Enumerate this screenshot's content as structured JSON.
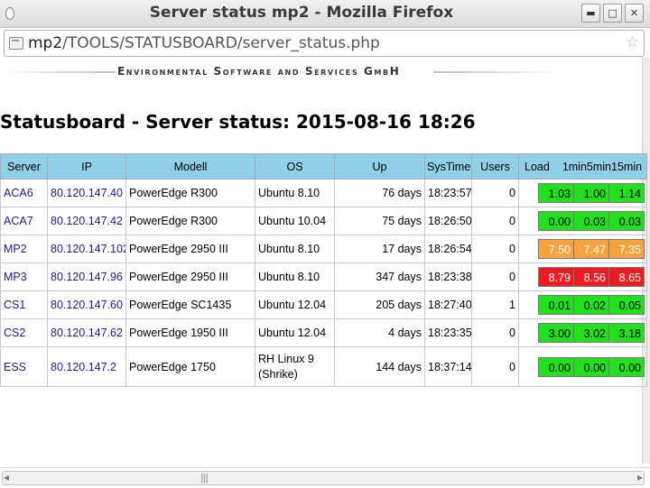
{
  "window": {
    "title": "Server status mp2 - Mozilla Firefox",
    "buttons": {
      "minimize": "▬",
      "maximize": "□",
      "close": "✕"
    }
  },
  "urlbar": {
    "host": "mp2",
    "path": "/TOOLS/STATUSBOARD/server_status.php",
    "bookmark_icon": "☆"
  },
  "banner": {
    "company": "Environmental Software and Services GmbH"
  },
  "page": {
    "heading": "Statusboard - Server status:  2015-08-16 18:26"
  },
  "table": {
    "headers": {
      "server": "Server",
      "ip": "IP",
      "modell": "Modell",
      "os": "OS",
      "up": "Up",
      "systime": "SysTime",
      "users": "Users",
      "load": "Load",
      "m1": "1min",
      "m5": "5min",
      "m15": "15min"
    },
    "rows": [
      {
        "server": "ACA6",
        "ip": "80.120.147.40",
        "modell": "PowerEdge R300",
        "os": "Ubuntu 8.10",
        "up": "76 days",
        "systime": "18:23:57",
        "users": "0",
        "load": [
          {
            "v": "1.03",
            "level": "green"
          },
          {
            "v": "1.00",
            "level": "green"
          },
          {
            "v": "1.14",
            "level": "green"
          }
        ]
      },
      {
        "server": "ACA7",
        "ip": "80.120.147.42",
        "modell": "PowerEdge R300",
        "os": "Ubuntu 10.04",
        "up": "75 days",
        "systime": "18:26:50",
        "users": "0",
        "load": [
          {
            "v": "0.00",
            "level": "green"
          },
          {
            "v": "0.03",
            "level": "green"
          },
          {
            "v": "0.03",
            "level": "green"
          }
        ]
      },
      {
        "server": "MP2",
        "ip": "80.120.147.102",
        "modell": "PowerEdge 2950 III",
        "os": "Ubuntu 8.10",
        "up": "17 days",
        "systime": "18:26:54",
        "users": "0",
        "load": [
          {
            "v": "7.50",
            "level": "orange"
          },
          {
            "v": "7.47",
            "level": "orange"
          },
          {
            "v": "7.35",
            "level": "orange"
          }
        ]
      },
      {
        "server": "MP3",
        "ip": "80.120.147.96",
        "modell": "PowerEdge 2950 III",
        "os": "Ubuntu 8.10",
        "up": "347 days",
        "systime": "18:23:38",
        "users": "0",
        "load": [
          {
            "v": "8.79",
            "level": "red"
          },
          {
            "v": "8.56",
            "level": "red"
          },
          {
            "v": "8.65",
            "level": "red"
          }
        ]
      },
      {
        "server": "CS1",
        "ip": "80.120.147.60",
        "modell": "PowerEdge SC1435",
        "os": "Ubuntu 12.04",
        "up": "205 days",
        "systime": "18:27:40",
        "users": "1",
        "load": [
          {
            "v": "0.01",
            "level": "green"
          },
          {
            "v": "0.02",
            "level": "green"
          },
          {
            "v": "0.05",
            "level": "green"
          }
        ]
      },
      {
        "server": "CS2",
        "ip": "80.120.147.62",
        "modell": "PowerEdge 1950 III",
        "os": "Ubuntu 12.04",
        "up": "4 days",
        "systime": "18:23:35",
        "users": "0",
        "load": [
          {
            "v": "3.00",
            "level": "green"
          },
          {
            "v": "3.02",
            "level": "green"
          },
          {
            "v": "3.18",
            "level": "green"
          }
        ]
      },
      {
        "server": "ESS",
        "ip": "80.120.147.2",
        "modell": "PowerEdge 1750",
        "os": "RH Linux 9 (Shrike)",
        "up": "144 days",
        "systime": "18:37:14",
        "users": "0",
        "load": [
          {
            "v": "0.00",
            "level": "green"
          },
          {
            "v": "0.00",
            "level": "green"
          },
          {
            "v": "0.00",
            "level": "green"
          }
        ]
      }
    ]
  },
  "colors": {
    "header_bg": "#8fcfe8",
    "load_green": "#22e01e",
    "load_orange": "#f4a340",
    "load_red": "#ec1b22",
    "link": "#1a1a9c"
  },
  "scrollbar": {
    "grip": "|||",
    "left_arrow": "◂",
    "right_arrow": "▸"
  }
}
